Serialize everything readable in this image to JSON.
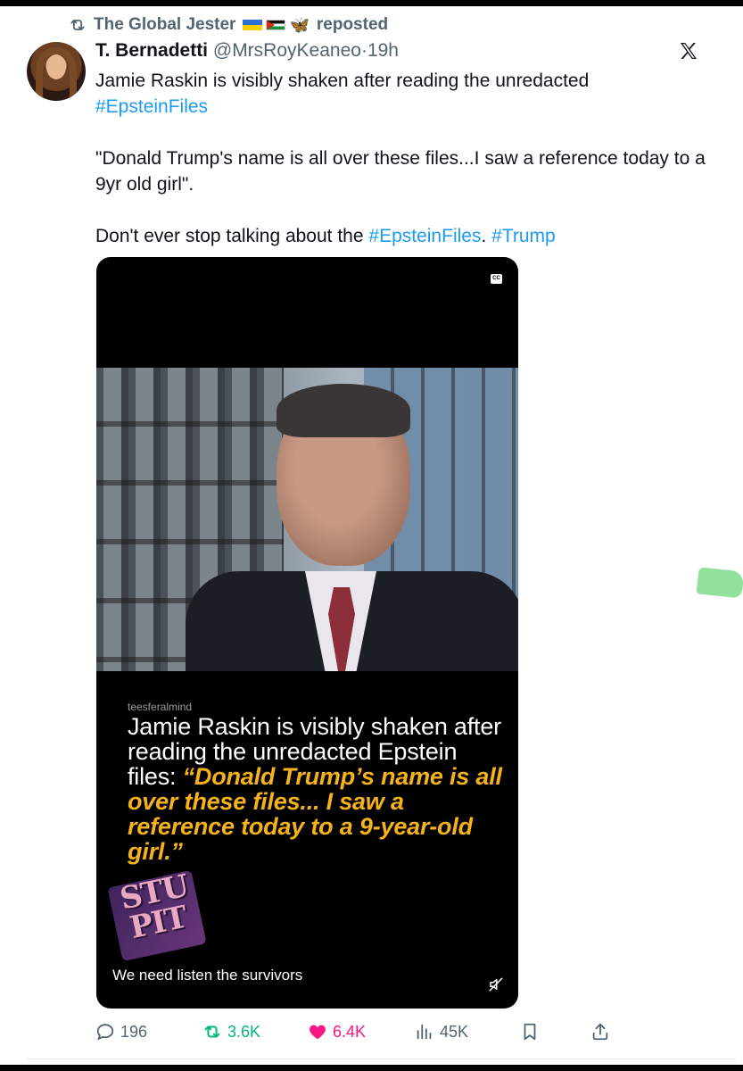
{
  "repost_header": {
    "user": "The Global Jester",
    "label": "reposted",
    "icons": [
      "repost-icon",
      "ukraine-flag-icon",
      "palestine-flag-icon",
      "butterfly-icon"
    ]
  },
  "tweet": {
    "display_name": "T. Bernadetti",
    "handle": "@MrsRoyKeaneo",
    "time": "19h",
    "separator": "·",
    "text_line1": "Jamie Raskin is visibly shaken after reading the unredacted",
    "hashtag_1": "#EpsteinFiles",
    "quote_text": "\"Donald Trump's name is all over these files...I saw a reference today to a 9yr old girl\".",
    "closing_text": "Don't ever stop talking about the",
    "hashtag_2": "#EpsteinFiles",
    "hashtag_sep": ".",
    "hashtag_3": "#Trump"
  },
  "media": {
    "cc_label": "CC",
    "watermark": "teesferalmind",
    "caption_plain": "Jamie Raskin is visibly shaken after reading the unredacted Epstein files: ",
    "caption_quote": "“Donald Trump’s name is all over these files... I saw a reference today to a 9-year-old girl.”",
    "sticker_line1": "STU",
    "sticker_line2": "PIT",
    "subtitle": "We need listen the survivors"
  },
  "actions": {
    "replies": "196",
    "reposts": "3.6K",
    "likes": "6.4K",
    "views": "45K"
  },
  "colors": {
    "link": "#1d9bf0",
    "secondary_text": "#536471",
    "repost_green": "#00ba7c",
    "like_pink": "#f91880",
    "caption_quote": "#f5b21a"
  }
}
